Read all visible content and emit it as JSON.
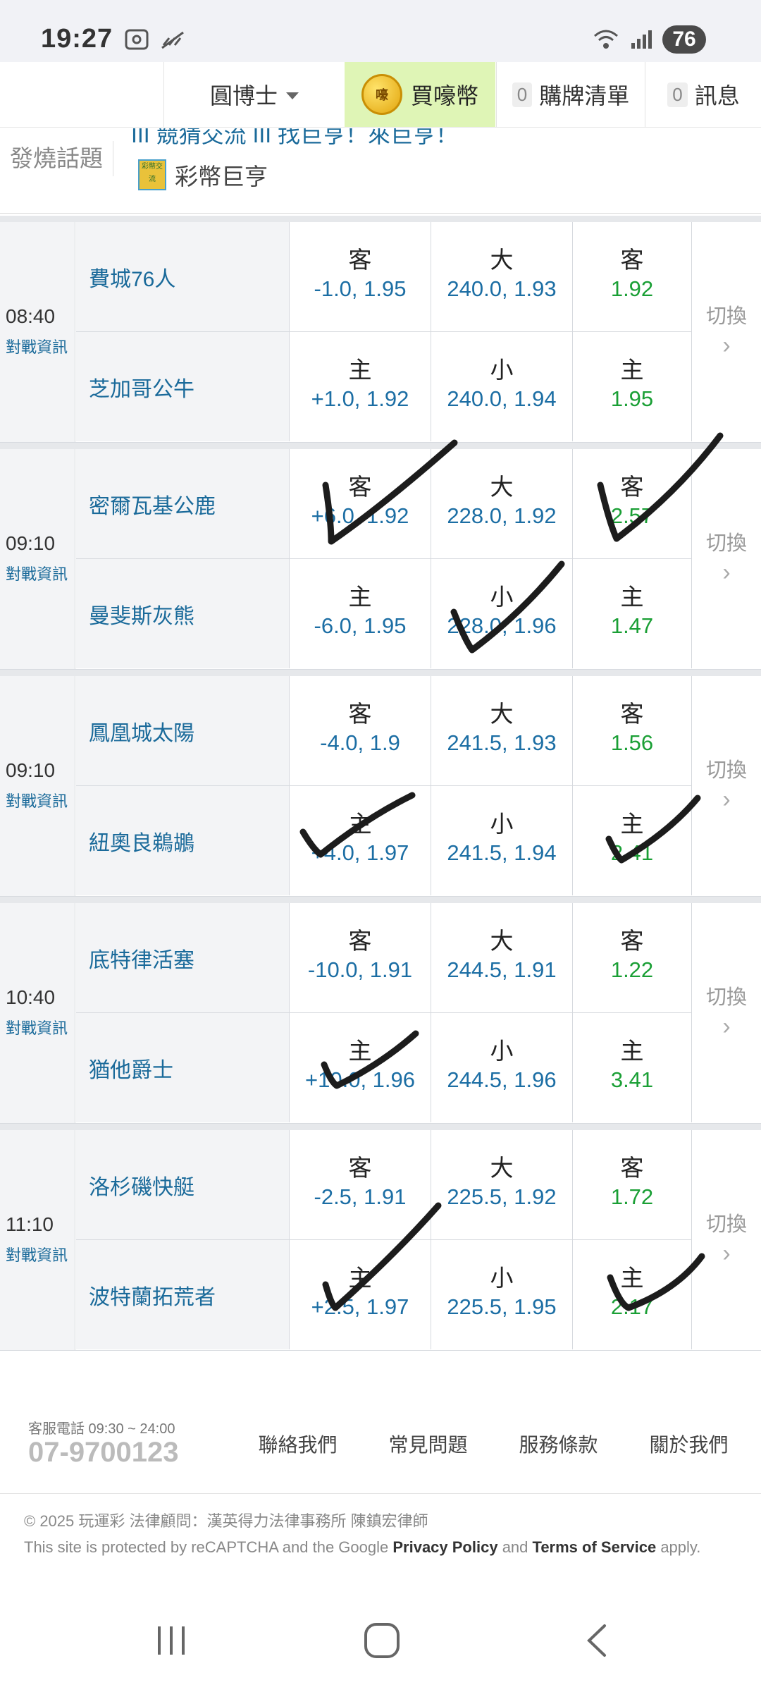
{
  "status_bar": {
    "time": "19:27",
    "battery": "76"
  },
  "nav": {
    "user": "圓博士",
    "buy_coin": "買嚎幣",
    "coin_icon": "嚎",
    "cart_count": "0",
    "cart": "購牌清單",
    "msg_count": "0",
    "messages": "訊息"
  },
  "hot_topic": {
    "label": "發燒話題",
    "line1": "III 競猜交流 III 找巨亨！來巨亨！",
    "line2": "彩幣巨亨",
    "icon_text": "彩幣交流"
  },
  "games": [
    {
      "time": "08:40",
      "info": "對戰資訊",
      "away": {
        "name": "費城76人",
        "spread_label": "客",
        "spread": "-1.0, 1.95",
        "ou_label": "大",
        "ou": "240.0, 1.93",
        "ml_label": "客",
        "ml": "1.92"
      },
      "home": {
        "name": "芝加哥公牛",
        "spread_label": "主",
        "spread": "+1.0, 1.92",
        "ou_label": "小",
        "ou": "240.0, 1.94",
        "ml_label": "主",
        "ml": "1.95"
      },
      "switch": "切換"
    },
    {
      "time": "09:10",
      "info": "對戰資訊",
      "away": {
        "name": "密爾瓦基公鹿",
        "spread_label": "客",
        "spread": "+6.0, 1.92",
        "ou_label": "大",
        "ou": "228.0, 1.92",
        "ml_label": "客",
        "ml": "2.57"
      },
      "home": {
        "name": "曼斐斯灰熊",
        "spread_label": "主",
        "spread": "-6.0, 1.95",
        "ou_label": "小",
        "ou": "228.0, 1.96",
        "ml_label": "主",
        "ml": "1.47"
      },
      "switch": "切換"
    },
    {
      "time": "09:10",
      "info": "對戰資訊",
      "away": {
        "name": "鳳凰城太陽",
        "spread_label": "客",
        "spread": "-4.0, 1.9",
        "ou_label": "大",
        "ou": "241.5, 1.93",
        "ml_label": "客",
        "ml": "1.56"
      },
      "home": {
        "name": "紐奧良鵜鶘",
        "spread_label": "主",
        "spread": "+4.0, 1.97",
        "ou_label": "小",
        "ou": "241.5, 1.94",
        "ml_label": "主",
        "ml": "2.41"
      },
      "switch": "切換"
    },
    {
      "time": "10:40",
      "info": "對戰資訊",
      "away": {
        "name": "底特律活塞",
        "spread_label": "客",
        "spread": "-10.0, 1.91",
        "ou_label": "大",
        "ou": "244.5, 1.91",
        "ml_label": "客",
        "ml": "1.22"
      },
      "home": {
        "name": "猶他爵士",
        "spread_label": "主",
        "spread": "+10.0, 1.96",
        "ou_label": "小",
        "ou": "244.5, 1.96",
        "ml_label": "主",
        "ml": "3.41"
      },
      "switch": "切換"
    },
    {
      "time": "11:10",
      "info": "對戰資訊",
      "away": {
        "name": "洛杉磯快艇",
        "spread_label": "客",
        "spread": "-2.5, 1.91",
        "ou_label": "大",
        "ou": "225.5, 1.92",
        "ml_label": "客",
        "ml": "1.72"
      },
      "home": {
        "name": "波特蘭拓荒者",
        "spread_label": "主",
        "spread": "+2.5, 1.97",
        "ou_label": "小",
        "ou": "225.5, 1.95",
        "ml_label": "主",
        "ml": "2.17"
      },
      "switch": "切換"
    }
  ],
  "footer": {
    "hours": "客服電話 09:30 ~ 24:00",
    "phone": "07-9700123",
    "links": [
      "聯絡我們",
      "常見問題",
      "服務條款",
      "關於我們"
    ],
    "copyright": "© 2025 玩運彩 法律顧問：漢英得力法律事務所 陳鎮宏律師",
    "recaptcha_prefix": "This site is protected by reCAPTCHA and the Google ",
    "privacy": "Privacy Policy",
    "and": " and ",
    "terms": "Terms of Service",
    "apply": " apply."
  },
  "colors": {
    "link_blue": "#1c6ea4",
    "odds_green": "#1a9f35",
    "buy_bg": "#dff5b6"
  }
}
